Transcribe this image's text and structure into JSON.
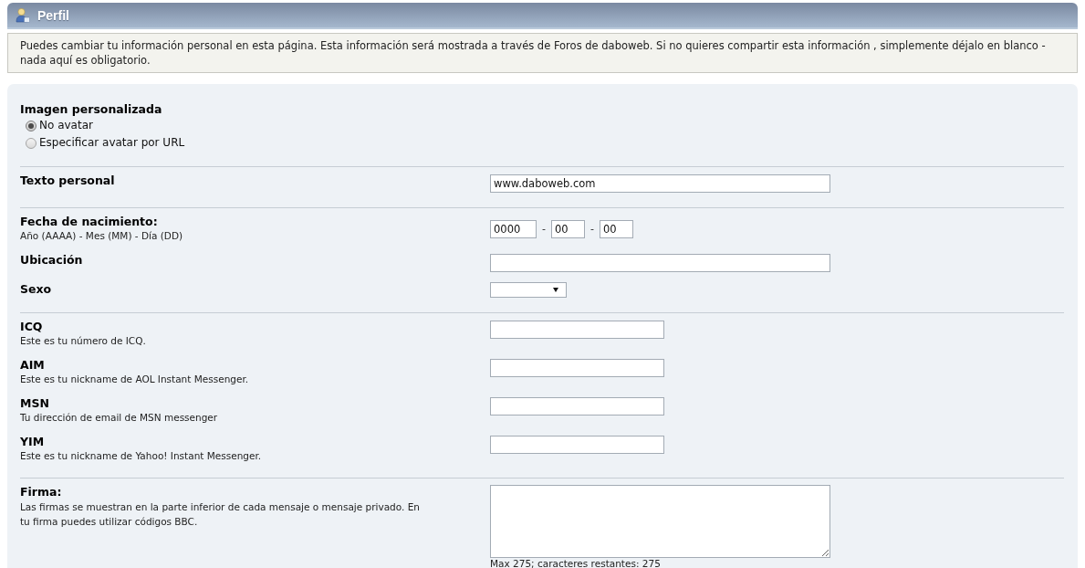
{
  "header": {
    "title": "Perfil"
  },
  "intro": "Puedes cambiar tu información personal en esta página. Esta información será mostrada a través de Foros de daboweb. Si no quieres compartir esta información , simplemente déjalo en blanco - nada aquí es obligatorio.",
  "form": {
    "sections": [
      {
        "fields": [
          {
            "kind": "radio",
            "label": "Imagen personalizada",
            "options": [
              {
                "label": "No avatar",
                "selected": true
              },
              {
                "label": "Especificar avatar por URL",
                "selected": false
              }
            ]
          }
        ]
      },
      {
        "fields": [
          {
            "kind": "text",
            "label": "Texto personal",
            "value": "www.daboweb.com"
          }
        ]
      },
      {
        "fields": [
          {
            "kind": "date",
            "label": "Fecha de nacimiento:",
            "hint": "Año (AAAA) - Mes (MM) - Día (DD)",
            "parts": [
              "0000",
              "00",
              "00"
            ],
            "separators": [
              "-",
              "-"
            ]
          },
          {
            "kind": "text",
            "label": "Ubicación"
          },
          {
            "kind": "select",
            "label": "Sexo"
          }
        ]
      },
      {
        "fields": [
          {
            "kind": "short_text",
            "label": "ICQ",
            "hint": "Este es tu número de ICQ."
          },
          {
            "kind": "short_text",
            "label": "AIM",
            "hint": "Este es tu nickname de AOL Instant Messenger."
          },
          {
            "kind": "short_text",
            "label": "MSN",
            "hint": "Tu dirección de email de MSN messenger"
          },
          {
            "kind": "short_text",
            "label": "YIM",
            "hint": "Este es tu nickname de Yahoo! Instant Messenger."
          }
        ]
      },
      {
        "fields": [
          {
            "kind": "textarea",
            "label": "Firma:",
            "hint": "Las firmas se muestran en la parte inferior de cada mensaje o mensaje privado. En tu firma puedes utilizar códigos BBC.",
            "counter": "Max 275; caracteres restantes: 275"
          }
        ]
      }
    ]
  }
}
